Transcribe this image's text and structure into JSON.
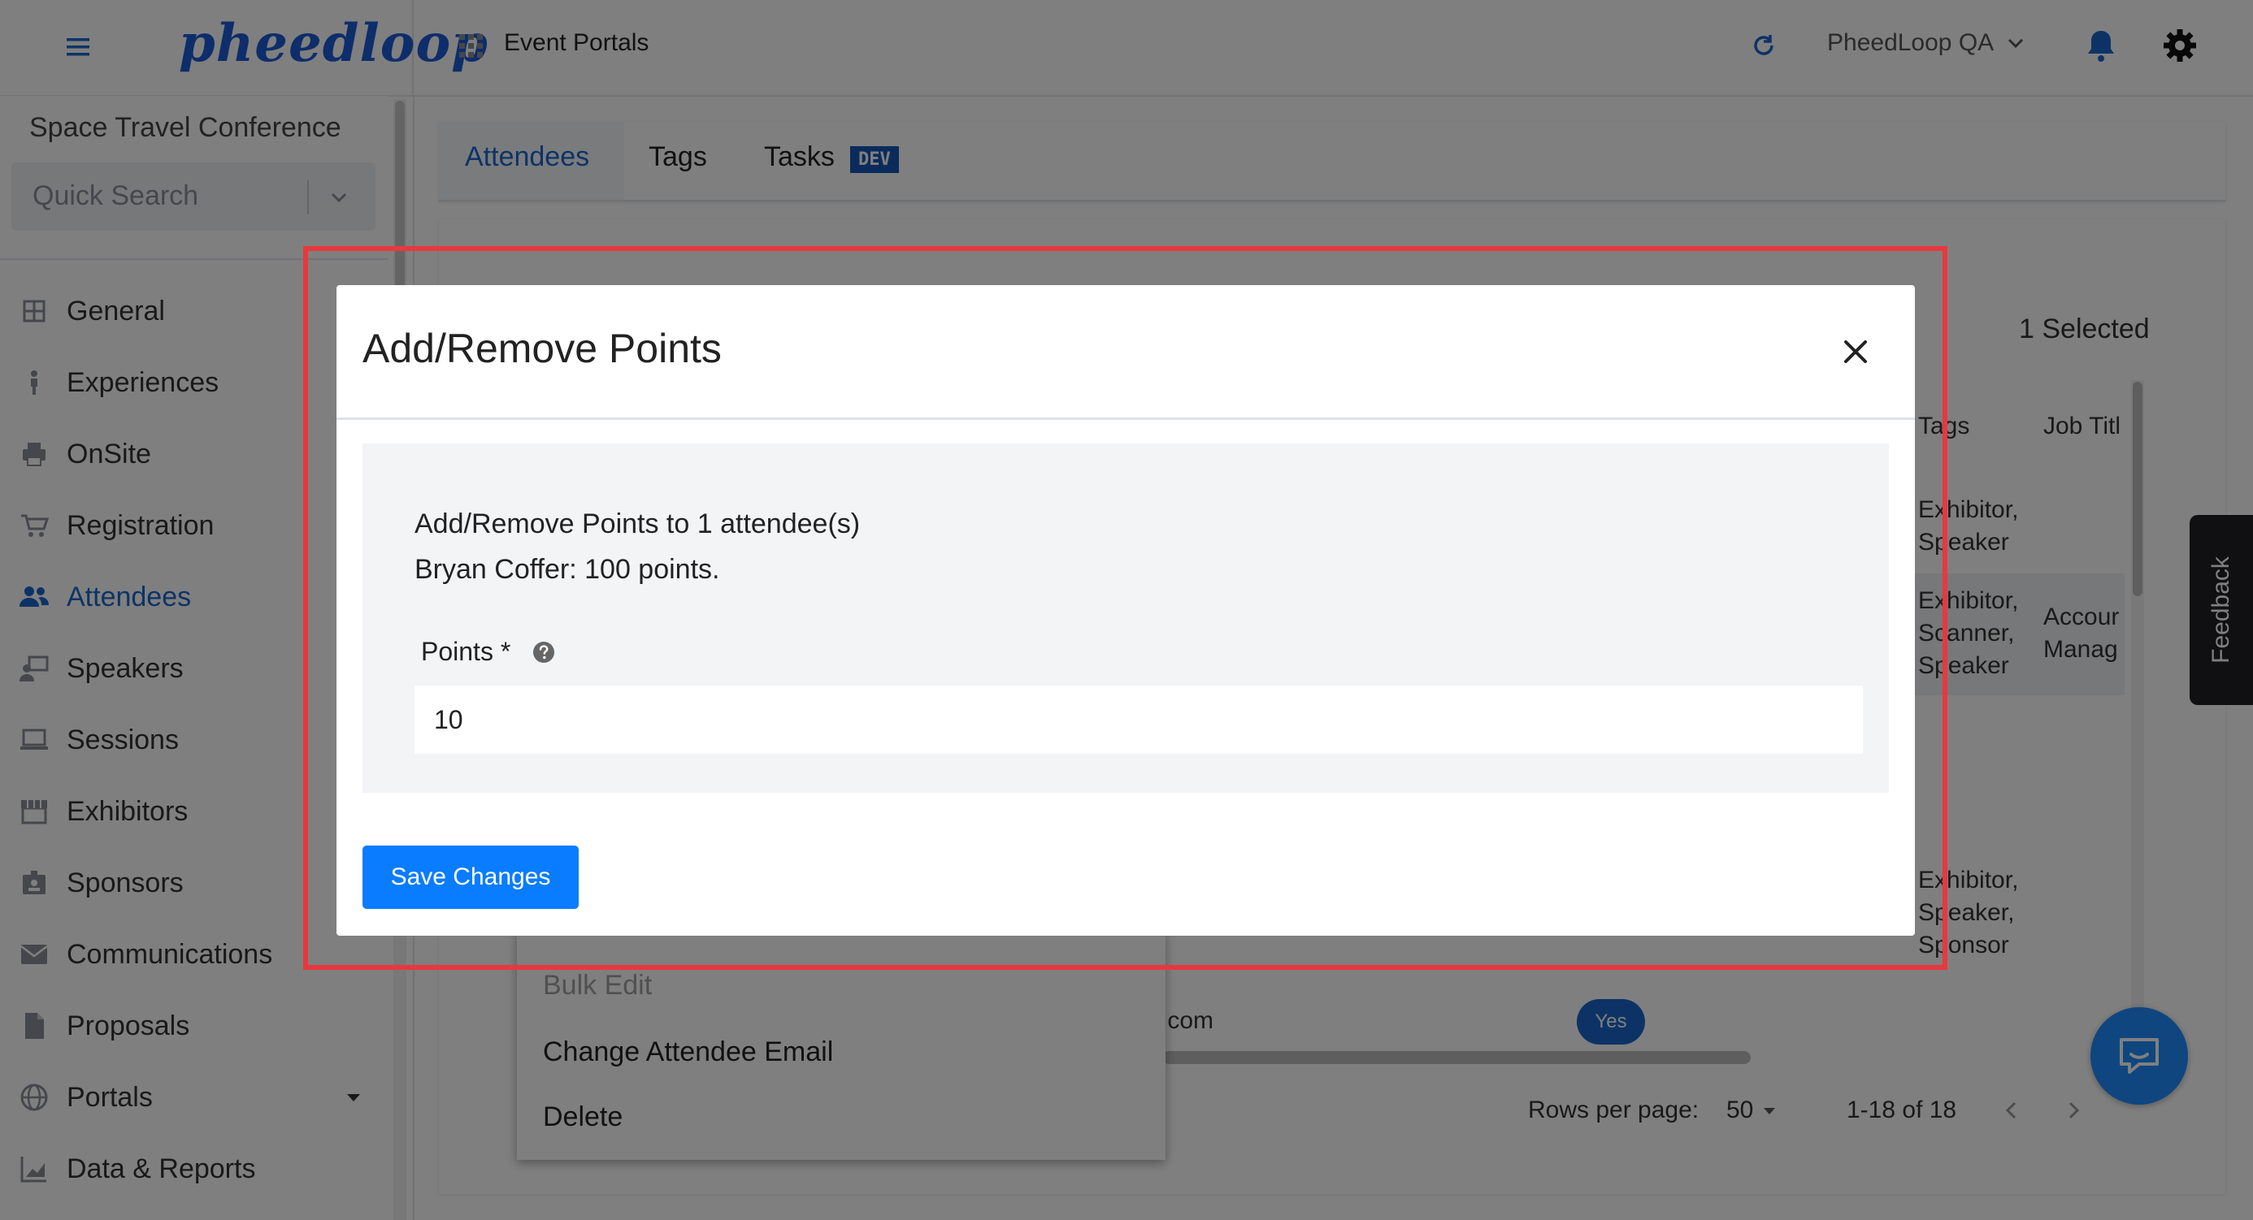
{
  "header": {
    "logo_text": "pheedloop",
    "portal_title": "Event Portals",
    "org_name": "PheedLoop QA"
  },
  "sidebar": {
    "event_name": "Space Travel Conference",
    "search_placeholder": "Quick Search",
    "items": [
      {
        "label": "General",
        "icon": "grid-icon"
      },
      {
        "label": "Experiences",
        "icon": "person-icon"
      },
      {
        "label": "OnSite",
        "icon": "printer-icon"
      },
      {
        "label": "Registration",
        "icon": "cart-icon"
      },
      {
        "label": "Attendees",
        "icon": "people-icon",
        "active": true
      },
      {
        "label": "Speakers",
        "icon": "presenter-icon"
      },
      {
        "label": "Sessions",
        "icon": "laptop-icon"
      },
      {
        "label": "Exhibitors",
        "icon": "store-icon"
      },
      {
        "label": "Sponsors",
        "icon": "badge-icon"
      },
      {
        "label": "Communications",
        "icon": "mail-icon"
      },
      {
        "label": "Proposals",
        "icon": "document-icon"
      },
      {
        "label": "Portals",
        "icon": "globe-icon"
      },
      {
        "label": "Data & Reports",
        "icon": "chart-icon"
      }
    ]
  },
  "tabs": {
    "attendees": "Attendees",
    "tags": "Tags",
    "tasks": "Tasks",
    "tasks_badge": "DEV"
  },
  "table": {
    "selected_count": "1 Selected",
    "columns": {
      "tags": "Tags",
      "job_title": "Job Titl"
    },
    "rows": [
      {
        "tags": [
          "Exhibitor,",
          "Speaker"
        ],
        "job_title": []
      },
      {
        "tags": [
          "Exhibitor,",
          "Scanner,",
          "Speaker"
        ],
        "job_title": [
          "Accour",
          "Manag"
        ]
      },
      {
        "tags": [
          "Exhibitor,",
          "Speaker,",
          "Sponsor"
        ],
        "job_title": []
      }
    ],
    "email_fragment": ".com",
    "yes_badge": "Yes",
    "pagination": {
      "rows_per_page_label": "Rows per page:",
      "rows_per_page_value": "50",
      "range": "1-18 of 18"
    }
  },
  "context_menu": {
    "bulk_edit": "Bulk Edit",
    "change_email": "Change Attendee Email",
    "delete": "Delete"
  },
  "feedback_label": "Feedback",
  "modal": {
    "title": "Add/Remove Points",
    "description": "Add/Remove Points to 1 attendee(s)",
    "current_points": "Bryan Coffer: 100 points.",
    "points_label": "Points *",
    "points_value": "10",
    "save_label": "Save Changes"
  },
  "colors": {
    "accent": "#1a66cc",
    "primary_button": "#0a7cff",
    "highlight_outline": "#e8383d"
  }
}
